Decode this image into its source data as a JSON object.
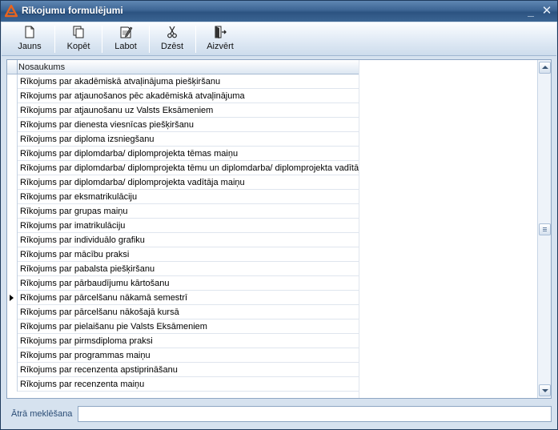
{
  "window": {
    "title": "Rīkojumu formulējumi",
    "minimize_glyph": "_",
    "close_glyph": "✕"
  },
  "toolbar": {
    "buttons": [
      {
        "label": "Jauns",
        "icon": "new-document-icon"
      },
      {
        "label": "Kopēt",
        "icon": "copy-icon"
      },
      {
        "label": "Labot",
        "icon": "edit-icon"
      },
      {
        "label": "Dzēst",
        "icon": "cut-icon"
      },
      {
        "label": "Aizvērt",
        "icon": "exit-door-icon"
      }
    ]
  },
  "grid": {
    "column_header": "Nosaukums",
    "current_row_index": 15,
    "rows": [
      "Rīkojums par akadēmiskā atvaļinājuma piešķiršanu",
      "Rīkojums par atjaunošanos pēc akadēmiskā atvaļinājuma",
      "Rīkojums par atjaunošanu uz Valsts Eksāmeniem",
      "Rīkojums par dienesta viesnīcas piešķiršanu",
      "Rīkojums par diploma izsniegšanu",
      "Rīkojums par diplomdarba/ diplomprojekta tēmas maiņu",
      "Rīkojums par diplomdarba/ diplomprojekta tēmu un  diplomdarba/ diplomprojekta vadītāja a",
      "Rīkojums par diplomdarba/ diplomprojekta vadītāja maiņu",
      "Rīkojums par eksmatrikulāciju",
      "Rīkojums par grupas maiņu",
      "Rīkojums par imatrikulāciju",
      "Rīkojums par individuālo grafiku",
      "Rīkojums par mācību praksi",
      "Rīkojums par pabalsta piešķiršanu",
      "Rīkojums par pārbaudījumu kārtošanu",
      "Rīkojums par pārcelšanu nākamā semestrī",
      "Rīkojums par pārcelšanu nākošajā kursā",
      "Rīkojums par pielaišanu pie Valsts Eksāmeniem",
      "Rīkojums par pirmsdiploma praksi",
      "Rīkojums par programmas maiņu",
      "Rīkojums par recenzenta apstiprināšanu",
      "Rīkojums par recenzenta maiņu"
    ]
  },
  "search": {
    "label": "Ātrā meklēšana",
    "value": ""
  },
  "colors": {
    "title_bar": "#3d6594",
    "accent_icon": "#e8641e",
    "search_label": "#2a4c75"
  }
}
